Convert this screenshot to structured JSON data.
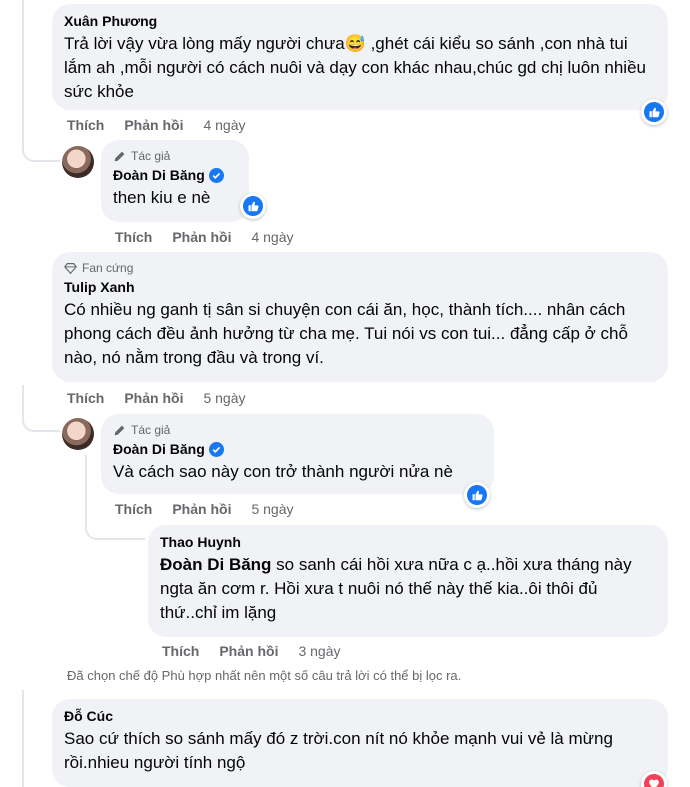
{
  "comments": [
    {
      "author": "Xuân Phương",
      "text": "Trả lời vậy vừa lòng mấy người chưa😅 ,ghét cái kiểu so sánh ,con nhà tui lắm ah ,mỗi người có cách nuôi và dạy con khác nhau,chúc gd chị luôn nhiều sức khỏe",
      "like": "Thích",
      "reply": "Phản hồi",
      "time": "4 ngày",
      "reaction": "like-reaction"
    },
    {
      "badge": "Tác giả",
      "author": "Đoàn Di Băng",
      "text": "then kiu e nè",
      "like": "Thích",
      "reply": "Phản hồi",
      "time": "4 ngày",
      "reaction": "like-reaction"
    },
    {
      "badge": "Fan cứng",
      "author": "Tulip Xanh",
      "text": "Có nhiều ng ganh tị sân si chuyện con cái ăn, học, thành tích.... nhân cách phong cách đều ảnh hưởng từ cha mẹ. Tui nói vs con tui... đẳng cấp ở chỗ nào, nó nằm trong đầu và trong ví.",
      "like": "Thích",
      "reply": "Phản hồi",
      "time": "5 ngày"
    },
    {
      "badge": "Tác giả",
      "author": "Đoàn Di Băng",
      "text": "Và cách sao này con trở thành người nửa nè",
      "like": "Thích",
      "reply": "Phản hồi",
      "time": "5 ngày",
      "reaction": "like-reaction"
    },
    {
      "author": "Thao Huynh",
      "mention": "Đoàn Di Băng",
      "text": " so sanh cái hồi xưa nữa c ạ..hồi xưa tháng này ngta ăn cơm r. Hồi xưa t nuôi nó thế này thế kia..ôi thôi đủ thứ..chỉ im lặng",
      "like": "Thích",
      "reply": "Phản hồi",
      "time": "3 ngày"
    },
    {
      "author": "Đỗ Cúc",
      "text": "Sao cứ thích so sánh mấy đó z trời.con nít nó khỏe mạnh vui vẻ là mừng rồi.nhieu người tính ngộ",
      "reaction": "love-reaction"
    }
  ],
  "filter_note": "Đã chọn chế độ Phù hợp nhất nên một số câu trả lời có thể bị lọc ra.",
  "colors": {
    "bubble": "#f0f2f5",
    "like_blue": "#1877f2",
    "love_red": "#f33e58",
    "meta_gray": "#65676b"
  }
}
